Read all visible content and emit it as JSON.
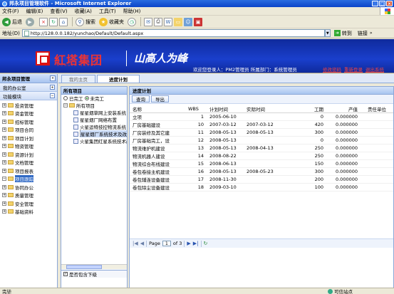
{
  "window": {
    "title": "邦永项目管理软件 - Microsoft Internet Explorer"
  },
  "menu": [
    "文件(F)",
    "编辑(E)",
    "查看(V)",
    "收藏(A)",
    "工具(T)",
    "帮助(H)"
  ],
  "toolbar": {
    "back": "后退",
    "search": "搜索",
    "favorites": "收藏夹"
  },
  "address": {
    "label": "地址(D)",
    "url": "http://128.0.0.182/yunchao/Default/Default.aspx",
    "go": "转到",
    "links": "链接"
  },
  "banner": {
    "brand": "紅塔集团",
    "brand_sub": "HONGTA GROUP",
    "slogan": "山高人为峰",
    "user_line": "欢迎您登录人：PM2管理员  所属部门：系统管理员",
    "links": [
      "修改密码",
      "重新登录",
      "退出系统"
    ]
  },
  "sidebar": {
    "title": "邦永项目管理",
    "office": "我的办公室",
    "modules": "功能模块",
    "items": [
      {
        "label": "投资管理",
        "expanded": false
      },
      {
        "label": "资金管理",
        "expanded": false
      },
      {
        "label": "招标管理",
        "expanded": false
      },
      {
        "label": "项目合同",
        "expanded": false
      },
      {
        "label": "项目计划",
        "expanded": false
      },
      {
        "label": "物资管理",
        "expanded": false
      },
      {
        "label": "资源计划",
        "expanded": false
      },
      {
        "label": "文档管理",
        "expanded": false
      },
      {
        "label": "项目报表",
        "expanded": false
      },
      {
        "label": "项目跟踪",
        "expanded": true,
        "selected": true
      },
      {
        "label": "协同办公",
        "expanded": false
      },
      {
        "label": "质量管理",
        "expanded": false
      },
      {
        "label": "安全管理",
        "expanded": false
      },
      {
        "label": "基础资料",
        "expanded": false
      }
    ]
  },
  "tabs": [
    {
      "label": "我的主页",
      "active": false
    },
    {
      "label": "进度计划",
      "active": true
    }
  ],
  "projects": {
    "title": "所有项目",
    "radio_done": "已完工",
    "radio_undone": "未完工",
    "root": "所有项目",
    "items": [
      {
        "label": "星星烟草网上安装系统",
        "selected": false
      },
      {
        "label": "星星烟厂网络布置",
        "selected": false
      },
      {
        "label": "火星运特技控物流系统",
        "selected": false
      },
      {
        "label": "星星烟厂系统技术及改造",
        "selected": true
      },
      {
        "label": "火星集团红星系统技术改",
        "selected": false
      }
    ],
    "include_sub": "是否包含下级"
  },
  "plan": {
    "title": "进度计划",
    "buttons": [
      "查询",
      "导出"
    ],
    "columns": [
      "名称",
      "WBS",
      "计划时间",
      "实际时间",
      "工期",
      "产值",
      "责任单位"
    ],
    "rows": [
      {
        "name": "立项",
        "wbs": "1",
        "plan": "2005-06-10",
        "actual": "",
        "duration": "0",
        "value": "0.000000",
        "unit": ""
      },
      {
        "name": "厂房基础建设",
        "wbs": "10",
        "plan": "2007-03-12",
        "actual": "2007-03-12",
        "duration": "420",
        "value": "0.000000",
        "unit": ""
      },
      {
        "name": "厂房装修及其它建",
        "wbs": "11",
        "plan": "2008-05-13",
        "actual": "2008-05-13",
        "duration": "300",
        "value": "0.000000",
        "unit": ""
      },
      {
        "name": "厂房基础完工，设",
        "wbs": "12",
        "plan": "2008-05-13",
        "actual": "",
        "duration": "0",
        "value": "0.000000",
        "unit": ""
      },
      {
        "name": "物流维护机建设",
        "wbs": "13",
        "plan": "2008-05-13",
        "actual": "2008-04-13",
        "duration": "250",
        "value": "0.000000",
        "unit": ""
      },
      {
        "name": "物流机器人建设",
        "wbs": "14",
        "plan": "2008-08-22",
        "actual": "",
        "duration": "250",
        "value": "0.000000",
        "unit": ""
      },
      {
        "name": "物流综合布线建设",
        "wbs": "15",
        "plan": "2008-06-13",
        "actual": "",
        "duration": "150",
        "value": "0.000000",
        "unit": ""
      },
      {
        "name": "卷包卷接主机建设",
        "wbs": "16",
        "plan": "2008-05-13",
        "actual": "2008-05-23",
        "duration": "300",
        "value": "0.000000",
        "unit": ""
      },
      {
        "name": "卷包辅连设备建设",
        "wbs": "17",
        "plan": "2008-11-30",
        "actual": "",
        "duration": "200",
        "value": "0.000000",
        "unit": ""
      },
      {
        "name": "卷包除尘设备建设",
        "wbs": "18",
        "plan": "2009-03-10",
        "actual": "",
        "duration": "100",
        "value": "0.000000",
        "unit": ""
      }
    ],
    "pager": {
      "page_label": "Page",
      "current": "1",
      "of": "of 3"
    }
  },
  "status": {
    "done": "完毕",
    "zone": "可信站点"
  }
}
